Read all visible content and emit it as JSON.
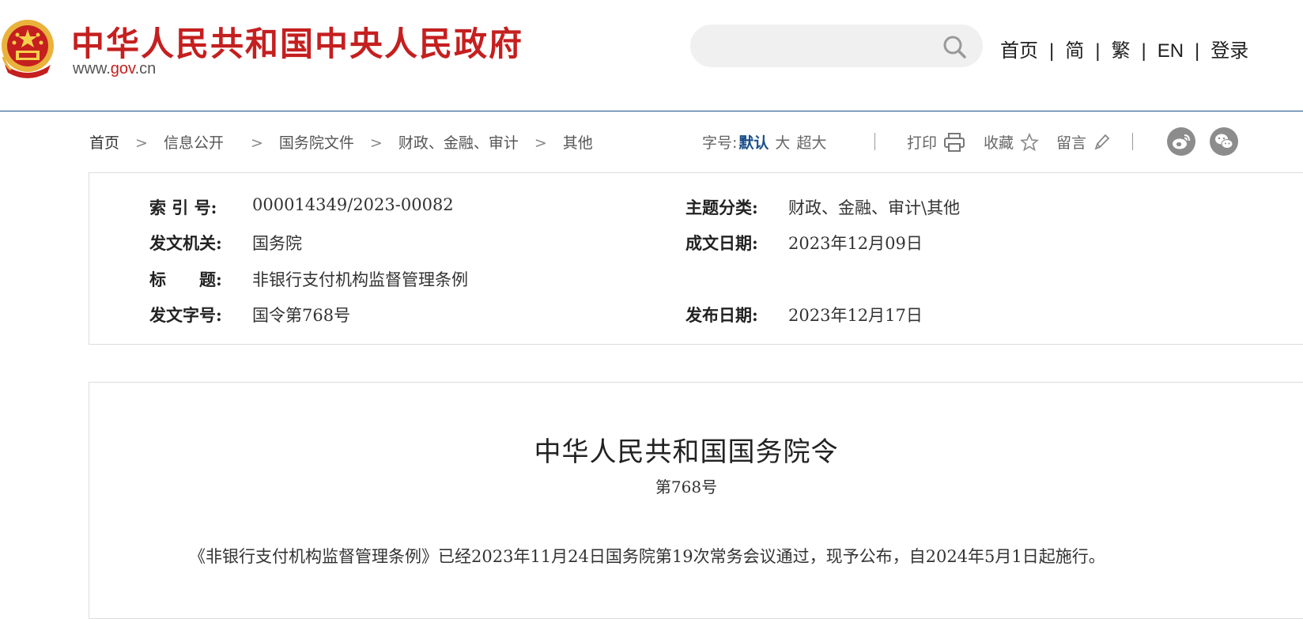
{
  "header": {
    "site_name": "中华人民共和国中央人民政府",
    "site_url_prefix": "www.",
    "site_url_accent": "gov",
    "site_url_suffix": ".cn",
    "search_placeholder": "",
    "nav": [
      "首页",
      "简",
      "繁",
      "EN",
      "登录"
    ],
    "nav_separator": "|"
  },
  "breadcrumb": {
    "items": [
      "首页",
      "信息公开",
      "国务院文件",
      "财政、金融、审计",
      "其他"
    ],
    "separator": ">"
  },
  "toolbar": {
    "fontsize_label": "字号:",
    "fontsize_options": [
      "默认",
      "大",
      "超大"
    ],
    "fontsize_active": "默认",
    "print_label": "打印",
    "favorite_label": "收藏",
    "comment_label": "留言",
    "share_icons": [
      "weibo-icon",
      "wechat-icon"
    ]
  },
  "meta": {
    "index_label": "索 引 号:",
    "index_value": "000014349/2023-00082",
    "issuer_label": "发文机关:",
    "issuer_value": "国务院",
    "title_label": "标　　题:",
    "title_value": "非银行支付机构监督管理条例",
    "docno_label": "发文字号:",
    "docno_value": "国令第768号",
    "topic_label": "主题分类:",
    "topic_value": "财政、金融、审计\\其他",
    "written_label": "成文日期:",
    "written_value": "2023年12月09日",
    "published_label": "发布日期:",
    "published_value": "2023年12月17日"
  },
  "document": {
    "title": "中华人民共和国国务院令",
    "number": "第768号",
    "paragraph": "《非银行支付机构监督管理条例》已经2023年11月24日国务院第19次常务会议通过，现予公布，自2024年5月1日起施行。"
  },
  "colors": {
    "brand_red": "#c51f1f",
    "accent_blue": "#1a4f8a",
    "border": "#dcdcdc"
  }
}
